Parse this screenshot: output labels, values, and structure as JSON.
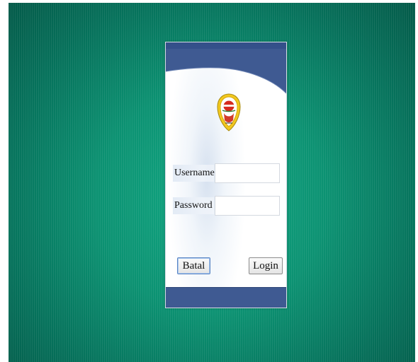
{
  "login_form": {
    "username_label": "Username",
    "username_value": "",
    "password_label": "Password",
    "password_value": "",
    "cancel_label": "Batal",
    "login_label": "Login",
    "logo_icon": "emblem-logo-icon"
  },
  "colors": {
    "background": "#0c9272",
    "panel_bar": "#3f5a92",
    "panel": "#ffffff"
  }
}
